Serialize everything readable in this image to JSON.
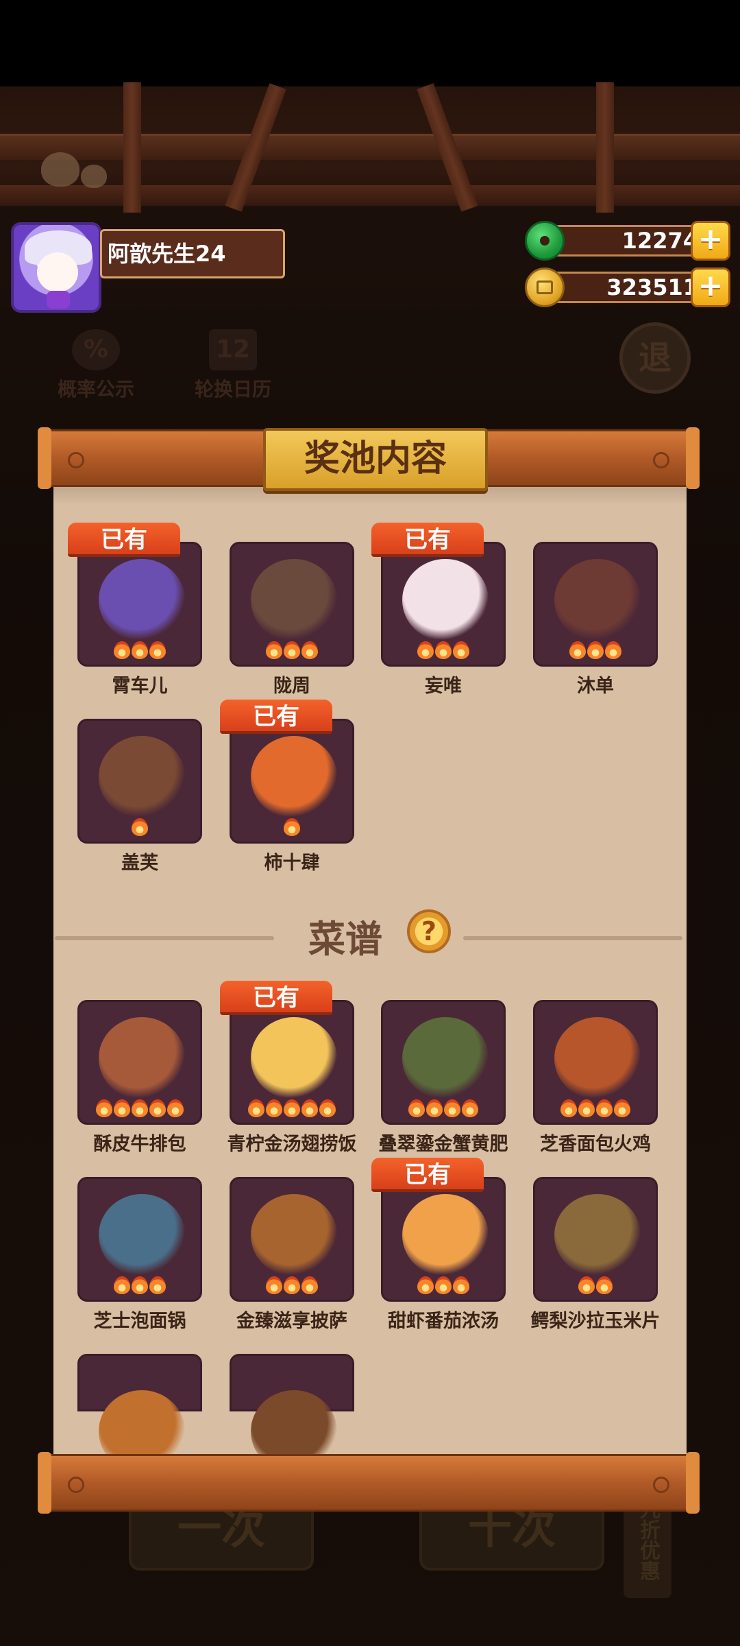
{
  "player": {
    "name": "阿歆先生24",
    "avatar": "player-avatar"
  },
  "currencies": [
    {
      "icon": "jade-icon",
      "value": "12274"
    },
    {
      "icon": "coin-icon",
      "value": "323511"
    }
  ],
  "plus_symbol": "+",
  "background_buttons": {
    "probability": "概率公示",
    "calendar": "轮换日历",
    "probability_icon": "%",
    "calendar_icon": "12",
    "exit": "退",
    "single_draw": "一次",
    "ten_draw": "十次",
    "discount": "九折优惠"
  },
  "panel_title": "奖池内容",
  "owned_label": "已有",
  "characters": [
    {
      "name": "霄车儿",
      "owned": true,
      "stars": 3,
      "color": "#6a4fb0"
    },
    {
      "name": "陇周",
      "owned": false,
      "stars": 3,
      "color": "#6a4a3c"
    },
    {
      "name": "妄唯",
      "owned": true,
      "stars": 3,
      "color": "#f3e1e8"
    },
    {
      "name": "沐单",
      "owned": false,
      "stars": 3,
      "color": "#6d3a34"
    },
    {
      "name": "盖芙",
      "owned": false,
      "stars": 1,
      "color": "#7a4a34"
    },
    {
      "name": "柿十肆",
      "owned": true,
      "stars": 1,
      "color": "#e26a2c"
    }
  ],
  "recipes_title": "菜谱",
  "help_icon": "?",
  "recipes": [
    {
      "name": "酥皮牛排包",
      "owned": false,
      "stars": 5,
      "color": "#a75a3a"
    },
    {
      "name": "青柠金汤翅捞饭",
      "owned": true,
      "stars": 5,
      "color": "#f2c45a"
    },
    {
      "name": "叠翠鎏金蟹黄肥",
      "owned": false,
      "stars": 4,
      "color": "#5a6a3a"
    },
    {
      "name": "芝香面包火鸡",
      "owned": false,
      "stars": 4,
      "color": "#b7562a"
    },
    {
      "name": "芝士泡面锅",
      "owned": false,
      "stars": 3,
      "color": "#4a6f8a"
    },
    {
      "name": "金臻滋享披萨",
      "owned": false,
      "stars": 3,
      "color": "#a8642e"
    },
    {
      "name": "甜虾番茄浓汤",
      "owned": true,
      "stars": 3,
      "color": "#f0a14a"
    },
    {
      "name": "鳄梨沙拉玉米片",
      "owned": false,
      "stars": 2,
      "color": "#8a6a3a"
    }
  ],
  "partial_recipes": [
    {
      "color": "#c2702e"
    },
    {
      "color": "#7a4a2a"
    }
  ]
}
